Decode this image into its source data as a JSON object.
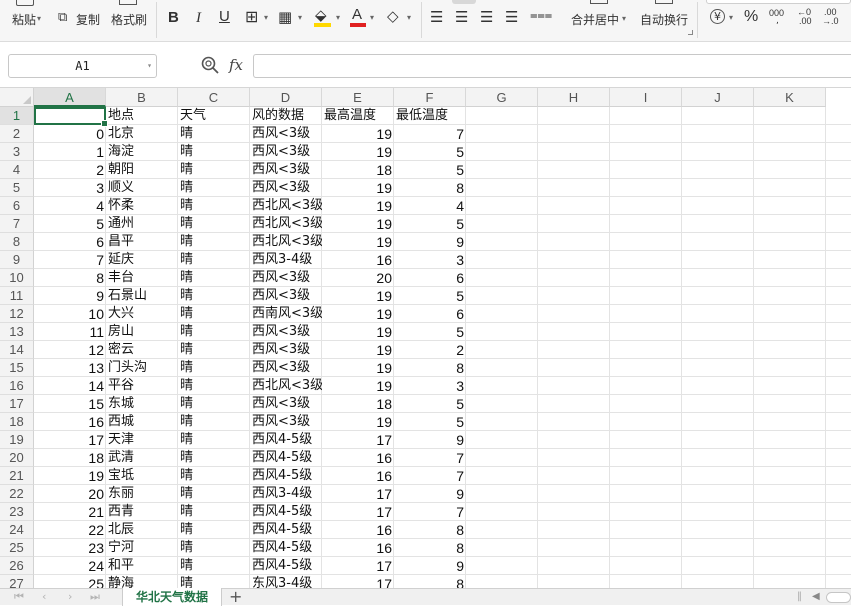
{
  "ribbon": {
    "paste_label": "粘贴",
    "copy_label": "复制",
    "format_painter_label": "格式刷",
    "bold": "B",
    "italic": "I",
    "underline": "U",
    "font_color_letter": "A",
    "merge_center_label": "合并居中",
    "wrap_text_label": "自动换行",
    "currency_symbol": "¥",
    "percent_symbol": "%",
    "thousands_top": "000",
    "dec_increase_top": "←0",
    "dec_increase_bottom": ".00",
    "dec_decrease_top": ".00",
    "dec_decrease_bottom": "→.0",
    "accent_color": "#217346",
    "font_color_bar": "#e02020",
    "fill_color_bar": "#ffd800"
  },
  "formula_bar": {
    "name_box": "A1",
    "fx": "fx",
    "formula": ""
  },
  "columns": [
    "A",
    "B",
    "C",
    "D",
    "E",
    "F",
    "G",
    "H",
    "I",
    "J",
    "K"
  ],
  "row_numbers": [
    "1",
    "2",
    "3",
    "4",
    "5",
    "6",
    "7",
    "8",
    "9",
    "10",
    "11",
    "12",
    "13",
    "14",
    "15",
    "16",
    "17",
    "18",
    "19",
    "20",
    "21",
    "22",
    "23",
    "24",
    "25",
    "26",
    "27"
  ],
  "header_row": [
    "",
    "地点",
    "天气",
    "风的数据",
    "最高温度",
    "最低温度"
  ],
  "rows": [
    [
      "0",
      "北京",
      "晴",
      "西风<3级",
      "19",
      "7"
    ],
    [
      "1",
      "海淀",
      "晴",
      "西风<3级",
      "19",
      "5"
    ],
    [
      "2",
      "朝阳",
      "晴",
      "西风<3级",
      "18",
      "5"
    ],
    [
      "3",
      "顺义",
      "晴",
      "西风<3级",
      "19",
      "8"
    ],
    [
      "4",
      "怀柔",
      "晴",
      "西北风<3级",
      "19",
      "4"
    ],
    [
      "5",
      "通州",
      "晴",
      "西北风<3级",
      "19",
      "5"
    ],
    [
      "6",
      "昌平",
      "晴",
      "西北风<3级",
      "19",
      "9"
    ],
    [
      "7",
      "延庆",
      "晴",
      "西风3-4级",
      "16",
      "3"
    ],
    [
      "8",
      "丰台",
      "晴",
      "西风<3级",
      "20",
      "6"
    ],
    [
      "9",
      "石景山",
      "晴",
      "西风<3级",
      "19",
      "5"
    ],
    [
      "10",
      "大兴",
      "晴",
      "西南风<3级",
      "19",
      "6"
    ],
    [
      "11",
      "房山",
      "晴",
      "西风<3级",
      "19",
      "5"
    ],
    [
      "12",
      "密云",
      "晴",
      "西风<3级",
      "19",
      "2"
    ],
    [
      "13",
      "门头沟",
      "晴",
      "西风<3级",
      "19",
      "8"
    ],
    [
      "14",
      "平谷",
      "晴",
      "西北风<3级",
      "19",
      "3"
    ],
    [
      "15",
      "东城",
      "晴",
      "西风<3级",
      "18",
      "5"
    ],
    [
      "16",
      "西城",
      "晴",
      "西风<3级",
      "19",
      "5"
    ],
    [
      "17",
      "天津",
      "晴",
      "西风4-5级",
      "17",
      "9"
    ],
    [
      "18",
      "武清",
      "晴",
      "西风4-5级",
      "16",
      "7"
    ],
    [
      "19",
      "宝坻",
      "晴",
      "西风4-5级",
      "16",
      "7"
    ],
    [
      "20",
      "东丽",
      "晴",
      "西风3-4级",
      "17",
      "9"
    ],
    [
      "21",
      "西青",
      "晴",
      "西风4-5级",
      "17",
      "7"
    ],
    [
      "22",
      "北辰",
      "晴",
      "西风4-5级",
      "16",
      "8"
    ],
    [
      "23",
      "宁河",
      "晴",
      "西风4-5级",
      "16",
      "8"
    ],
    [
      "24",
      "和平",
      "晴",
      "西风4-5级",
      "17",
      "9"
    ],
    [
      "25",
      "静海",
      "晴",
      "东风3-4级",
      "17",
      "8"
    ]
  ],
  "sheet_tab": "华北天气数据",
  "add_sheet": "+"
}
